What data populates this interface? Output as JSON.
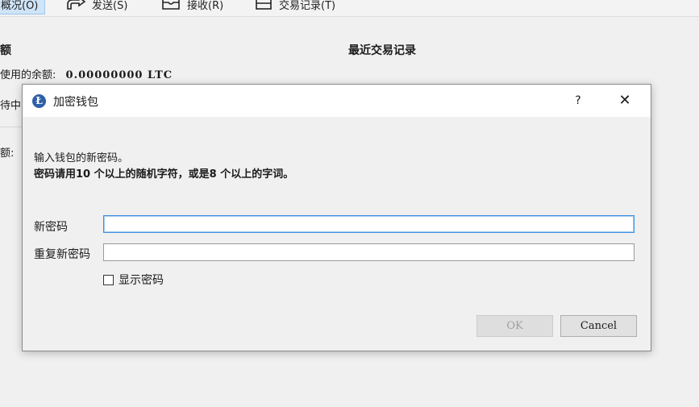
{
  "toolbar": {
    "overview": "概况(O)",
    "send": "发送(S)",
    "receive": "接收(R)",
    "transactions": "交易记录(T)"
  },
  "overview": {
    "balances_heading": "额",
    "recent_transactions_heading": "最近交易记录",
    "available_label": "使用的余额:",
    "available_value": "0.00000000 LTC",
    "pending_label": "待中",
    "total_label": "额:"
  },
  "dialog": {
    "title": "加密钱包",
    "help": "?",
    "close": "✕",
    "instruction_line1": "输入钱包的新密码。",
    "instruction_line2": "密码请用10 个以上的随机字符，或是8 个以上的字词。",
    "new_password_label": "新密码",
    "repeat_password_label": "重复新密码",
    "new_password_value": "",
    "repeat_password_value": "",
    "show_password_label": "显示密码",
    "show_password_checked": false,
    "ok_label": "OK",
    "cancel_label": "Cancel",
    "ok_enabled": false
  },
  "colors": {
    "accent": "#2f5fa8",
    "focus_border": "#3d8ee0",
    "active_tab": "#cfe4f7"
  }
}
